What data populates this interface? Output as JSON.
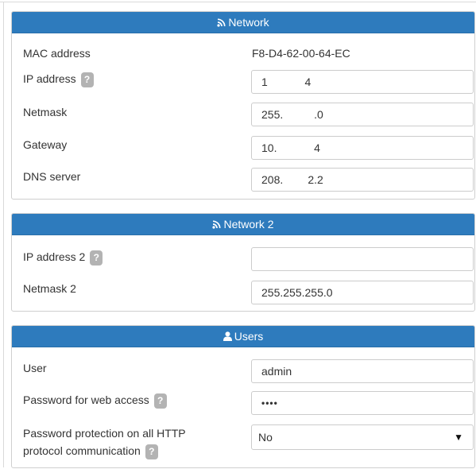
{
  "network": {
    "title": "Network",
    "mac_label": "MAC address",
    "mac_value": "F8-D4-62-00-64-EC",
    "ip_label": "IP address",
    "ip_value": "1            4",
    "netmask_label": "Netmask",
    "netmask_value": "255.          .0",
    "gateway_label": "Gateway",
    "gateway_value": "10.            4",
    "dns_label": "DNS server",
    "dns_value": "208.        2.2"
  },
  "network2": {
    "title": "Network 2",
    "ip_label": "IP address 2",
    "ip_value": "",
    "netmask_label": "Netmask 2",
    "netmask_value": "255.255.255.0"
  },
  "users": {
    "title": "Users",
    "user_label": "User",
    "user_value": "admin",
    "password_label": "Password for web access",
    "password_value": "••••",
    "protection_label_line1": "Password protection on all HTTP",
    "protection_label_line2": "protocol communication",
    "protection_value": "No"
  },
  "help_glyph": "?",
  "icons": {
    "network": "rss-icon",
    "users": "user-icon",
    "help": "question-icon",
    "select": "caret-down-icon"
  },
  "colors": {
    "header_bg": "#2e7bbd",
    "help_bg": "#b3b3b3",
    "border": "#cccccc"
  }
}
